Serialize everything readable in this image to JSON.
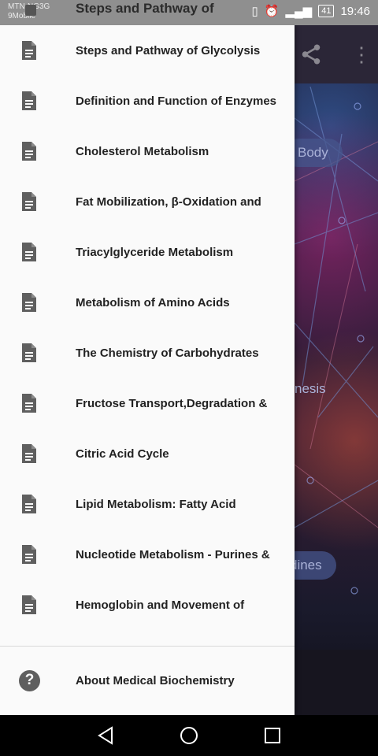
{
  "status_bar": {
    "carrier_line1": "MTN-NG3G",
    "carrier_line2": "9Mobile",
    "battery": "41",
    "time": "19:46",
    "peek_title": "Steps and Pathway of"
  },
  "background": {
    "chip_1": "Body",
    "chip_2": "nesis",
    "chip_3": "dines"
  },
  "drawer": {
    "items": [
      {
        "label": "Steps and Pathway of Glycolysis"
      },
      {
        "label": "Definition and Function of Enzymes"
      },
      {
        "label": "Cholesterol Metabolism"
      },
      {
        "label": "Fat Mobilization, β-Oxidation and"
      },
      {
        "label": "Triacylglyceride Metabolism"
      },
      {
        "label": "Metabolism of Amino Acids"
      },
      {
        "label": "The Chemistry of Carbohydrates"
      },
      {
        "label": "Fructose Transport,Degradation &"
      },
      {
        "label": "Citric Acid Cycle"
      },
      {
        "label": "Lipid Metabolism: Fatty Acid"
      },
      {
        "label": "Nucleotide Metabolism - Purines &"
      },
      {
        "label": "Hemoglobin and Movement of"
      }
    ],
    "about_label": "About Medical Biochemistry",
    "item_icon": "document-icon",
    "about_icon": "help-icon"
  },
  "colors": {
    "drawer_bg": "#fafafa",
    "icon": "#5f5f5f",
    "text": "#222222"
  }
}
